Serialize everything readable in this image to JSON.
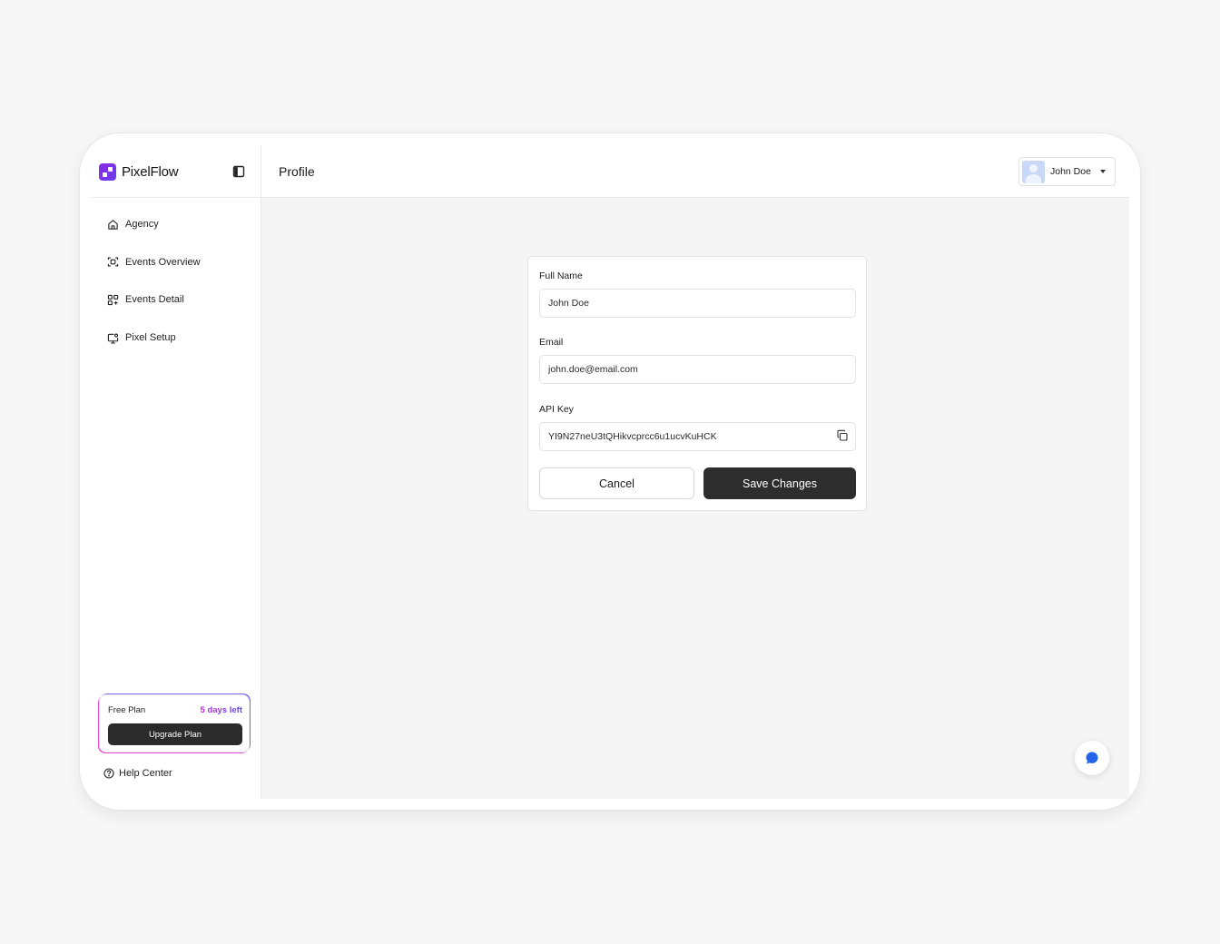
{
  "brand": {
    "name": "PixelFlow"
  },
  "sidebar": {
    "items": [
      {
        "label": "Agency",
        "icon": "home-icon"
      },
      {
        "label": "Events Overview",
        "icon": "scan-icon"
      },
      {
        "label": "Events Detail",
        "icon": "grid-icon"
      },
      {
        "label": "Pixel Setup",
        "icon": "monitor-settings-icon"
      }
    ],
    "plan": {
      "name": "Free Plan",
      "days_left": "5 days left",
      "upgrade_label": "Upgrade Plan"
    },
    "help_label": "Help Center"
  },
  "header": {
    "title": "Profile",
    "user": {
      "name": "John Doe"
    }
  },
  "form": {
    "full_name": {
      "label": "Full Name",
      "value": "John Doe"
    },
    "email": {
      "label": "Email",
      "value": "john.doe@email.com"
    },
    "api_key": {
      "label": "API Key",
      "value": "YI9N27neU3tQHikvcprcc6u1ucvKuHCK"
    },
    "cancel_label": "Cancel",
    "save_label": "Save Changes"
  },
  "colors": {
    "brand": "#7b2ff0",
    "primary_button": "#2d2d2d",
    "chat_icon": "#2563eb",
    "plan_gradient_start": "#c026d3",
    "plan_gradient_end": "#5b4de8"
  }
}
